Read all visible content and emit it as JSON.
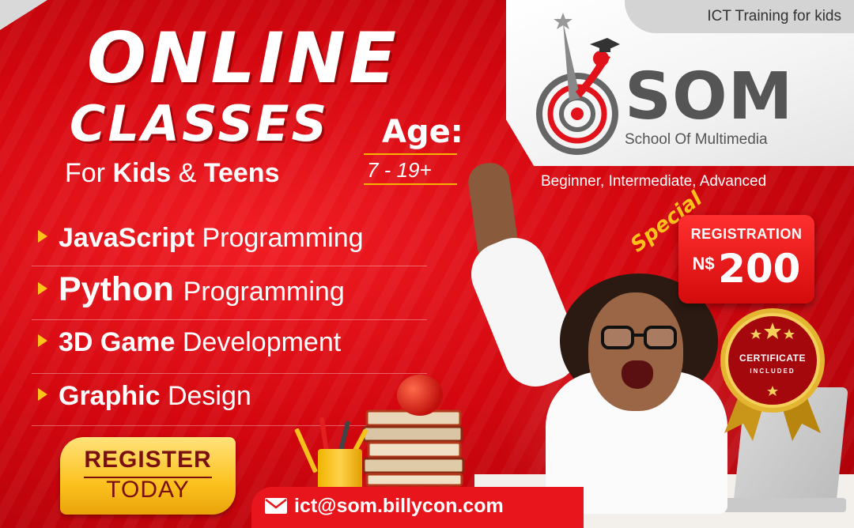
{
  "tagline": "ICT Training for kids",
  "brand": {
    "name": "SOM",
    "full_name": "School Of Multimedia"
  },
  "levels": "Beginner, Intermediate, Advanced",
  "headline": {
    "line1": "ONLINE",
    "line2": "CLASSES"
  },
  "audience": {
    "prefix": "For",
    "group1": "Kids",
    "joiner": "&",
    "group2": "Teens"
  },
  "age": {
    "label": "Age:",
    "range": "7 - 19+"
  },
  "courses": [
    {
      "bold": "JavaScript",
      "rest": "Programming"
    },
    {
      "bold": "Python",
      "rest": "Programming"
    },
    {
      "bold": "3D Game",
      "rest": "Development"
    },
    {
      "bold": "Graphic",
      "rest": "Design"
    }
  ],
  "register": {
    "line1": "REGISTER",
    "line2": "TODAY"
  },
  "email": "ict@som.billycon.com",
  "offer": {
    "special": "Special",
    "label": "REGISTRATION",
    "currency": "N$",
    "amount": "200"
  },
  "certificate": {
    "title": "CERTIFICATE",
    "subtitle": "INCLUDED"
  },
  "colors": {
    "primary_red": "#d4070f",
    "accent_gold": "#fcc21f",
    "brand_grey": "#555555"
  },
  "icons": [
    "envelope-icon",
    "arrow-bullet-icon",
    "graduation-cap-icon",
    "target-icon",
    "star-icon"
  ]
}
